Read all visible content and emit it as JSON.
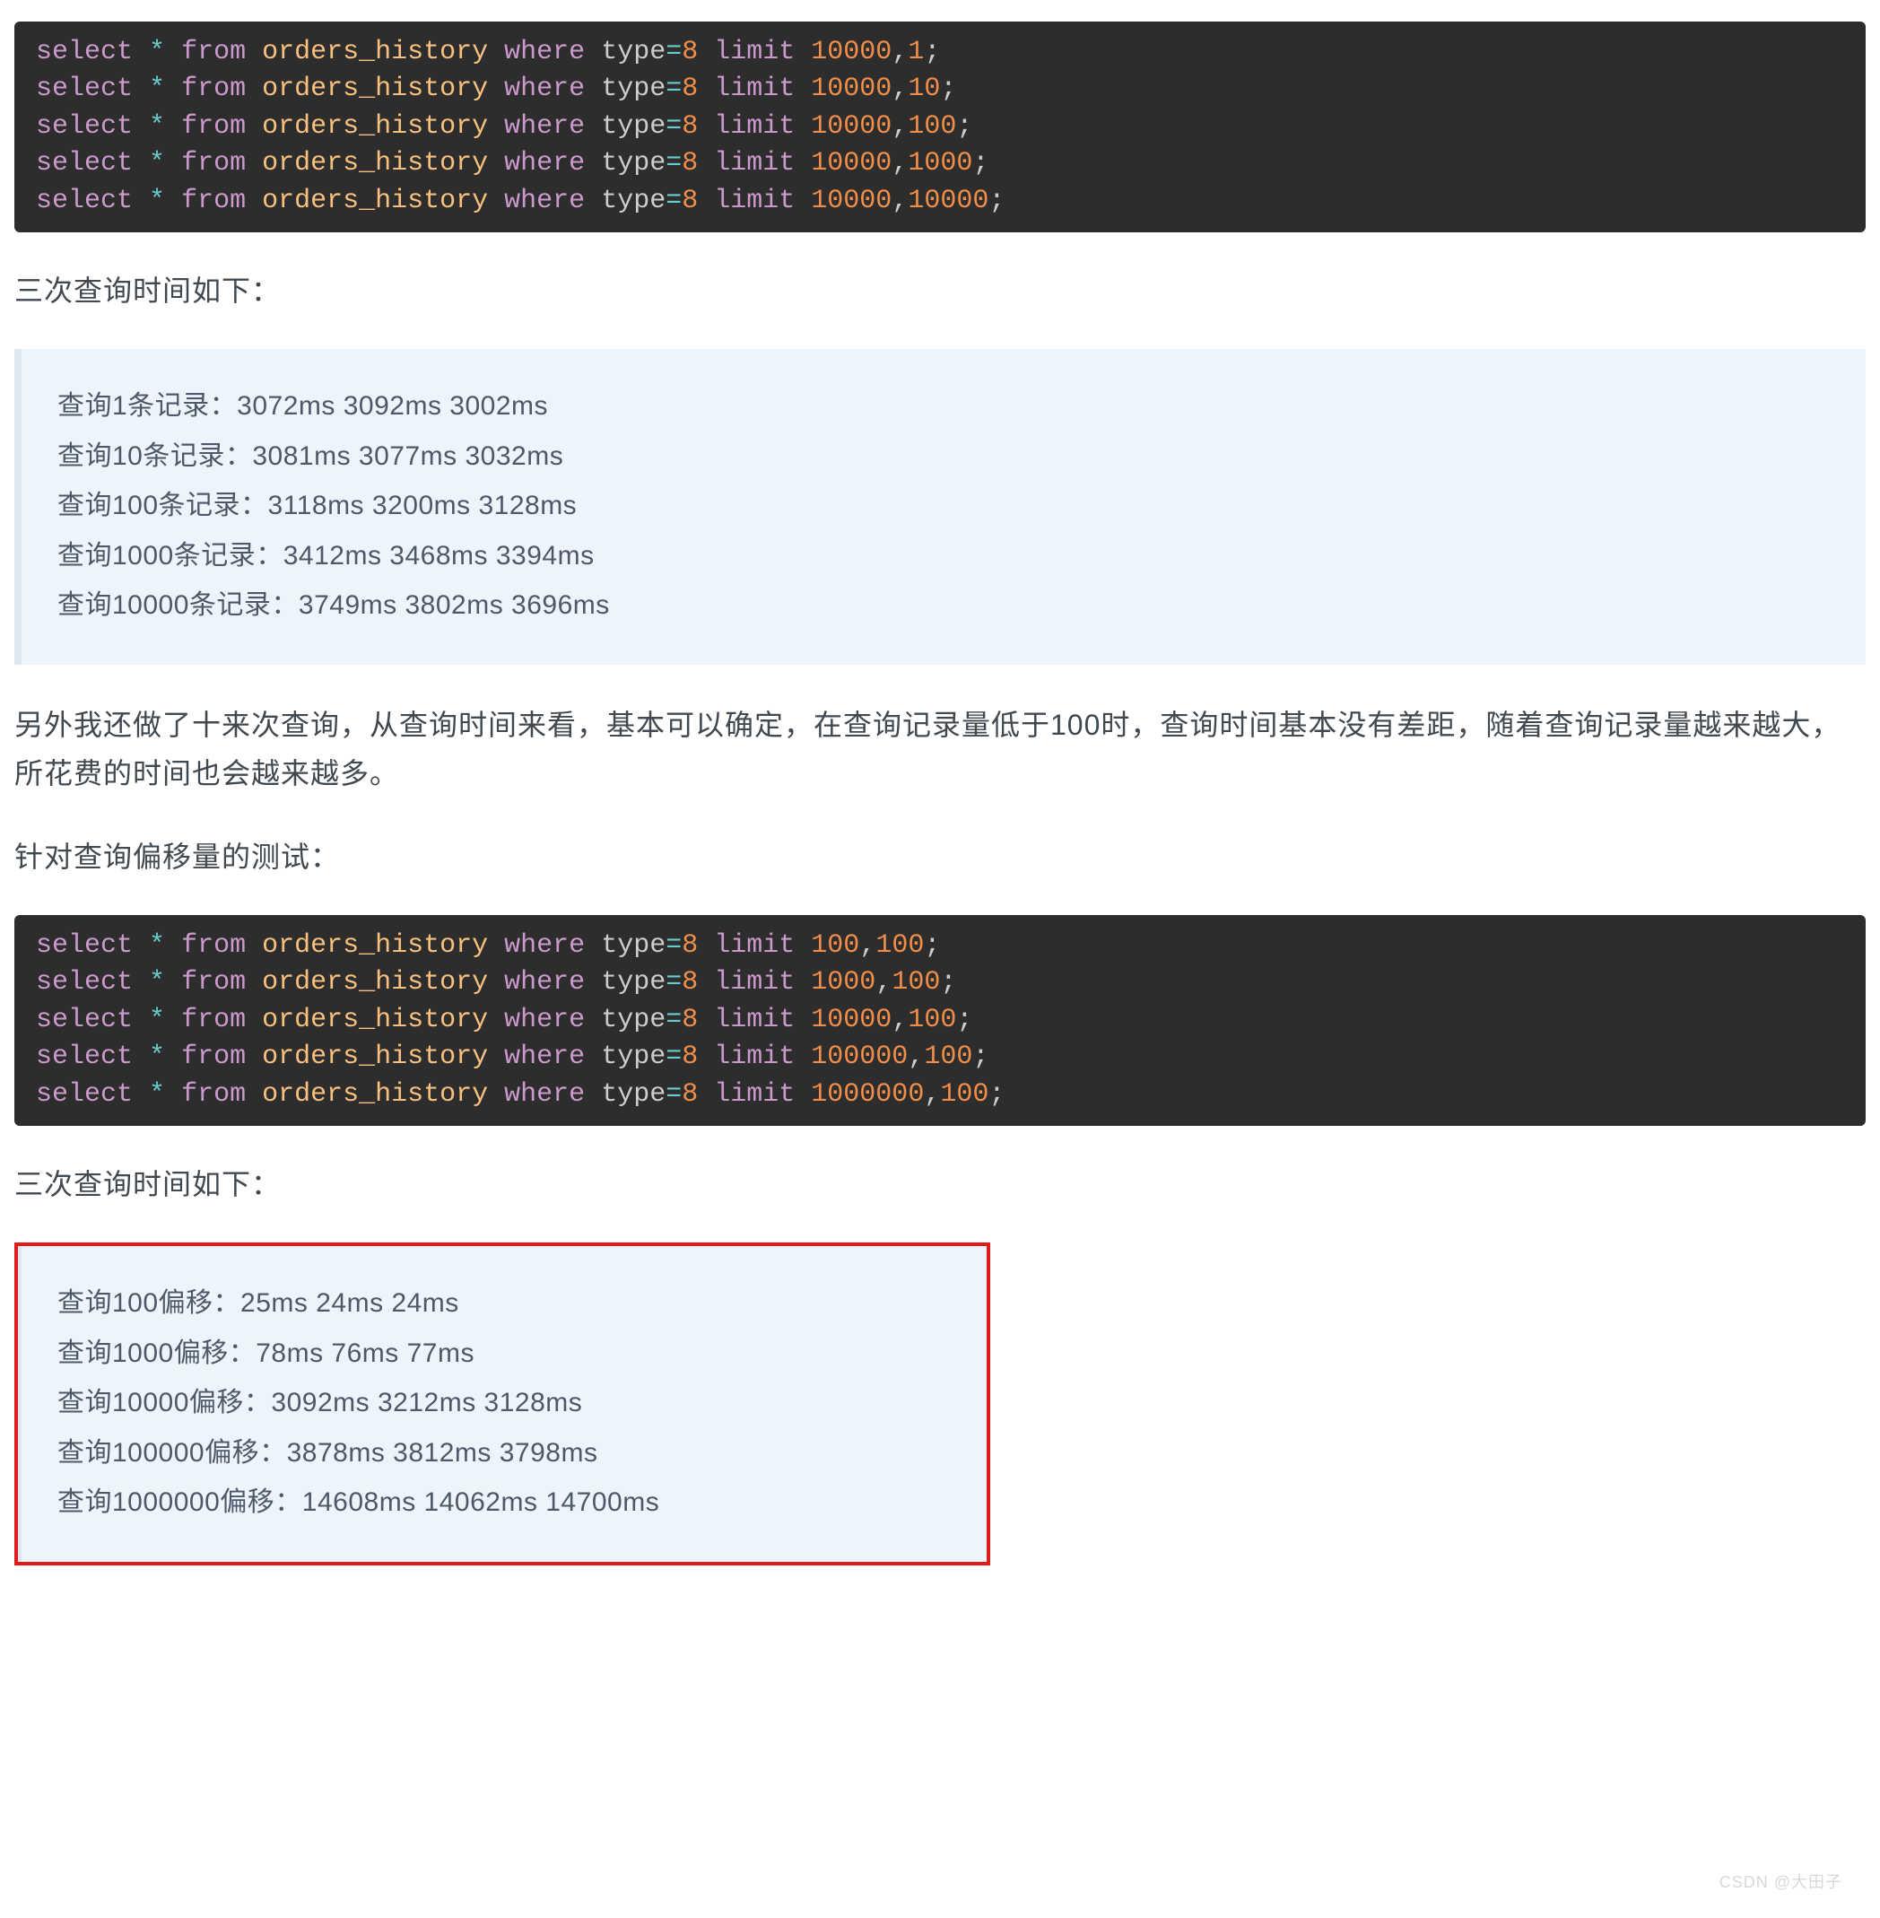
{
  "code1": {
    "lines": [
      {
        "offset": "10000",
        "rows": "1"
      },
      {
        "offset": "10000",
        "rows": "10"
      },
      {
        "offset": "10000",
        "rows": "100"
      },
      {
        "offset": "10000",
        "rows": "1000"
      },
      {
        "offset": "10000",
        "rows": "10000"
      }
    ]
  },
  "text1": "三次查询时间如下：",
  "quote1": [
    "查询1条记录：3072ms 3092ms 3002ms",
    "查询10条记录：3081ms 3077ms 3032ms",
    "查询100条记录：3118ms 3200ms 3128ms",
    "查询1000条记录：3412ms 3468ms 3394ms",
    "查询10000条记录：3749ms 3802ms 3696ms"
  ],
  "text2": "另外我还做了十来次查询，从查询时间来看，基本可以确定，在查询记录量低于100时，查询时间基本没有差距，随着查询记录量越来越大，所花费的时间也会越来越多。",
  "text3": "针对查询偏移量的测试：",
  "code2": {
    "lines": [
      {
        "offset": "100",
        "rows": "100"
      },
      {
        "offset": "1000",
        "rows": "100"
      },
      {
        "offset": "10000",
        "rows": "100"
      },
      {
        "offset": "100000",
        "rows": "100"
      },
      {
        "offset": "1000000",
        "rows": "100"
      }
    ]
  },
  "text4": "三次查询时间如下：",
  "quote2": [
    "查询100偏移：25ms 24ms 24ms",
    "查询1000偏移：78ms 76ms 77ms",
    "查询10000偏移：3092ms 3212ms 3128ms",
    "查询100000偏移：3878ms 3812ms 3798ms",
    "查询1000000偏移：14608ms 14062ms 14700ms"
  ],
  "sql_template": {
    "select": "select",
    "star": "*",
    "from": "from",
    "table": "orders_history",
    "where": "where",
    "typekw": "type",
    "eq": "=",
    "typeval": "8",
    "limit": "limit",
    "comma": ",",
    "semi": ";"
  },
  "watermark": "CSDN @大田子"
}
